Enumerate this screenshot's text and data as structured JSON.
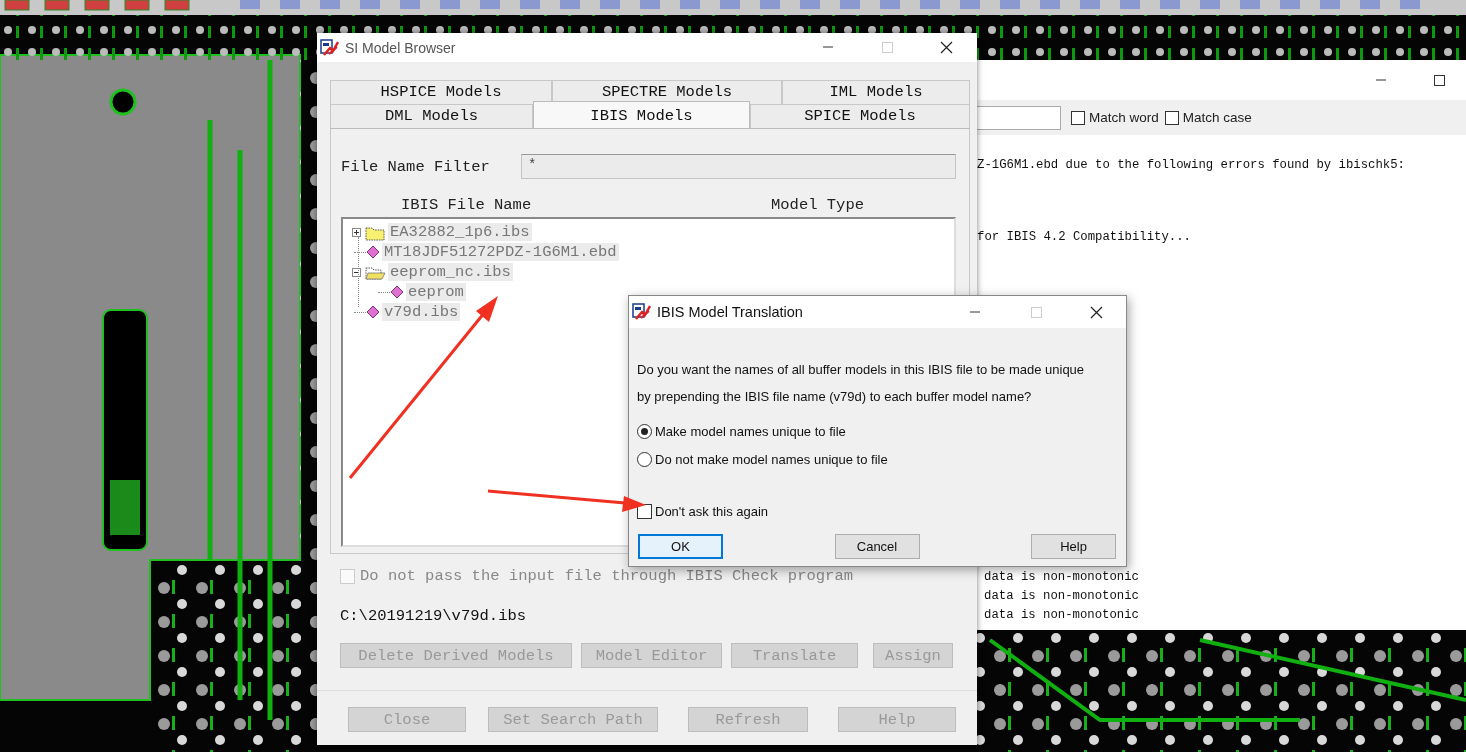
{
  "log_window": {
    "search_options": [
      {
        "label": "Match word",
        "checked": false
      },
      {
        "label": "Match case",
        "checked": false
      }
    ],
    "messages": [
      "Z-1G6M1.ebd due to the following errors found by ibischk5:",
      "for IBIS 4.2 Compatibility..."
    ],
    "warnings": [
      "data is non-monotonic",
      "data is non-monotonic",
      "data is non-monotonic"
    ]
  },
  "model_browser": {
    "title": "SI Model Browser",
    "tab_rows": [
      [
        {
          "label": "HSPICE Models",
          "selected": false
        },
        {
          "label": "SPECTRE Models",
          "selected": false
        },
        {
          "label": "IML Models",
          "selected": false
        }
      ],
      [
        {
          "label": "DML Models",
          "selected": false
        },
        {
          "label": "IBIS Models",
          "selected": true
        },
        {
          "label": "SPICE Models",
          "selected": false
        }
      ]
    ],
    "filter": {
      "label": "File Name Filter",
      "value": "*"
    },
    "columns": [
      "IBIS File Name",
      "Model Type"
    ],
    "tree": [
      {
        "name": "EA32882_1p6.ibs",
        "kind": "folder",
        "expanded": false
      },
      {
        "name": "MT18JDF51272PDZ-1G6M1.ebd",
        "kind": "file"
      },
      {
        "name": "eeprom_nc.ibs",
        "kind": "folder",
        "expanded": true,
        "children": [
          {
            "name": "eeprom",
            "kind": "file"
          }
        ]
      },
      {
        "name": "v79d.ibs",
        "kind": "file"
      }
    ],
    "skip_check": {
      "label": "Do not pass the input file through IBIS Check program",
      "checked": false,
      "disabled": true
    },
    "path": "C:\\20191219\\v79d.ibs",
    "actions": [
      {
        "label": "Delete Derived Models",
        "disabled": true
      },
      {
        "label": "Model Editor",
        "disabled": true
      },
      {
        "label": "Translate",
        "disabled": true
      },
      {
        "label": "Assign",
        "disabled": true
      }
    ],
    "footer_buttons": [
      {
        "label": "Close",
        "disabled": true
      },
      {
        "label": "Set Search Path",
        "disabled": true
      },
      {
        "label": "Refresh",
        "disabled": true
      },
      {
        "label": "Help",
        "disabled": true
      }
    ]
  },
  "translation_dialog": {
    "title": "IBIS Model Translation",
    "message_lines": [
      "Do you want the names of all buffer models in this IBIS file to be made unique",
      "by prepending the IBIS file name (v79d) to each buffer model name?"
    ],
    "options": [
      {
        "label": "Make model names unique to file",
        "selected": true
      },
      {
        "label": "Do not make model names unique to file",
        "selected": false
      }
    ],
    "dont_ask": {
      "label": "Don't ask this again",
      "checked": false
    },
    "buttons": [
      {
        "label": "OK",
        "default": true
      },
      {
        "label": "Cancel",
        "default": false
      },
      {
        "label": "Help",
        "default": false
      }
    ]
  }
}
